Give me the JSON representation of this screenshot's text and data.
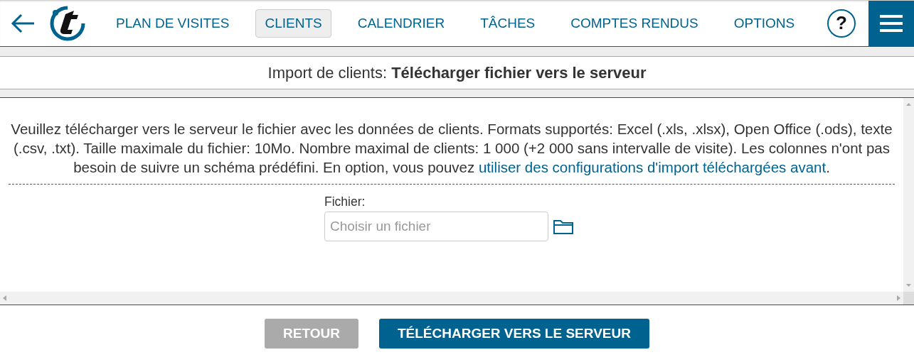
{
  "nav": [
    {
      "label": "PLAN DE VISITES",
      "selected": false
    },
    {
      "label": "CLIENTS",
      "selected": true
    },
    {
      "label": "CALENDRIER",
      "selected": false
    },
    {
      "label": "TÂCHES",
      "selected": false
    },
    {
      "label": "COMPTES RENDUS",
      "selected": false
    },
    {
      "label": "OPTIONS",
      "selected": false
    }
  ],
  "help": "?",
  "page_title": "Import de clients: **Télécharger fichier vers le serveur**",
  "intro": {
    "text": "Veuillez télécharger vers le serveur le fichier avec les données de clients. Formats supportés: Excel (.xls, .xlsx), Open Office (.ods), texte (.csv, .txt). Taille maximale du fichier: 10Mo. Nombre maximal de clients: 1 000 (+2 000 sans intervalle de visite). Les colonnes n'ont pas besoin de suivre un schéma prédéfini. En option, vous pouvez ",
    "link": "utiliser des configurations d'import téléchargées avant",
    "after": "."
  },
  "file_field": {
    "label": "Fichier:",
    "placeholder": "Choisir un fichier"
  },
  "buttons": [
    {
      "label": "RETOUR",
      "disabled": true
    },
    {
      "label": "TÉLÉCHARGER VERS LE SERVEUR",
      "disabled": false
    }
  ]
}
